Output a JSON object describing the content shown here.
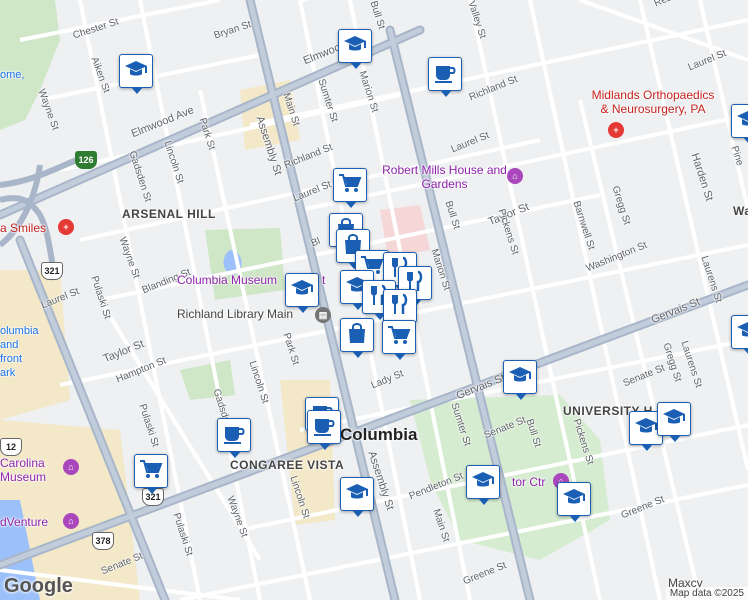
{
  "map": {
    "labels": {
      "city": "Columbia",
      "arsenal_hill": "ARSENAL HILL",
      "congaree_vista": "CONGAREE VISTA",
      "university": "UNIVERSITY H"
    },
    "streets": {
      "chester": "Chester St",
      "bryan": "Bryan St",
      "aiken": "Aiken St",
      "wayne_n": "Wayne St",
      "wayne_mid": "Wayne St",
      "wayne_s": "Wayne St",
      "elmwood": "Elmwood Ave",
      "marion_n": "Marion St",
      "marion_s": "Marion St",
      "bull_n": "Bull St",
      "bull_mid": "Bull St",
      "bull_s": "Bull St",
      "sumter_n": "Sumter St",
      "sumter_s": "Sumter St",
      "main_n": "Main St",
      "main_s": "Main St",
      "laurel_w": "Laurel St",
      "laurel_mid": "Laurel St",
      "laurel_e": "Laurel St",
      "laurel_ne": "Laurel St",
      "richland_e": "Richland St",
      "richland_w": "Richland St",
      "park_n": "Park St",
      "park_s": "Park St",
      "lincoln_n": "Lincoln St",
      "lincoln_mid": "Lincoln St",
      "lincoln_s": "Lincoln St",
      "gadsden_n": "Gadsden St",
      "gadsden_mid": "Gadsden St",
      "assembly_n": "Assembly St",
      "assembly_s": "Assembly St",
      "blanding": "Blanding St",
      "pulaski_n": "Pulaski St",
      "pulaski_s": "Pulaski St",
      "pulaski_mid": "Pulaski St",
      "taylor_w": "Taylor St",
      "taylor_e": "Taylor St",
      "hampton": "Hampton St",
      "lady": "Lady St",
      "gervais_mid": "Gervais St",
      "gervais_e": "Gervais St",
      "senate_e": "Senate St",
      "senate_mid": "Senate St",
      "senate_sw": "Senate St",
      "pendleton": "Pendleton St",
      "greene_s": "Greene St",
      "greene_e": "Greene St",
      "pickens_n": "Pickens St",
      "pickens_s": "Pickens St",
      "barnwell": "Barnwell St",
      "gregg_n": "Gregg St",
      "gregg_s": "Gregg St",
      "harden": "Harden St",
      "laurens_n": "Laurens St",
      "laurens_s": "Laurens St",
      "washington": "Washington St",
      "valley": "Valley St",
      "read": "Read",
      "pine": "Pine",
      "wa": "Wa",
      "bl": "Bl"
    },
    "pois": {
      "midlands": "Midlands Orthopaedics & Neurosurgery, PA",
      "robert_mills": "Robert Mills House and Gardens",
      "columbia_museum": "Columbia Museum",
      "columbia_museum_tail": "t",
      "richland_library": "Richland Library Main",
      "smiles": "a Smiles",
      "carolina_museum": "Carolina Museum",
      "edventure": "dVenture",
      "ctr": "tor Ctr",
      "columbia_front": "olumbia",
      "columbia_front2": "and",
      "columbia_front3": "front",
      "columbia_front4": "ark",
      "home": "ome,",
      "maxcy": "Maxcy"
    },
    "shields": {
      "i126": "126",
      "us321_n": "321",
      "us321_s": "321",
      "us378": "378",
      "r12": "12"
    },
    "attribution": "Map data ©2025",
    "google": "Google",
    "pin_icons": [
      "school-icon",
      "school-icon",
      "coffee-icon",
      "school-icon",
      "grocery-icon",
      "shopping-icon",
      "shopping-icon",
      "grocery-icon",
      "restaurant-icon",
      "restaurant-icon",
      "school-icon",
      "restaurant-icon",
      "restaurant-icon",
      "shopping-icon",
      "grocery-icon",
      "school-icon",
      "coffee-icon",
      "coffee-icon",
      "coffee-icon",
      "grocery-icon",
      "school-icon",
      "school-icon",
      "school-icon",
      "school-icon",
      "school-icon"
    ]
  }
}
